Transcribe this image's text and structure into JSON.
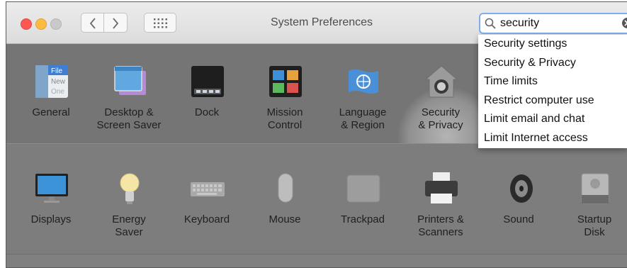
{
  "window": {
    "title": "System Preferences"
  },
  "search": {
    "value": "security"
  },
  "suggestions": [
    "Security settings",
    "Security & Privacy",
    "Time limits",
    "Restrict computer use",
    "Limit email and chat",
    "Limit Internet access"
  ],
  "row1": [
    {
      "label": "General",
      "icon": "general-icon"
    },
    {
      "label": "Desktop &\nScreen Saver",
      "icon": "desktop-icon"
    },
    {
      "label": "Dock",
      "icon": "dock-icon"
    },
    {
      "label": "Mission\nControl",
      "icon": "mission-control-icon"
    },
    {
      "label": "Language\n& Region",
      "icon": "globe-flag-icon"
    },
    {
      "label": "Security\n& Privacy",
      "icon": "house-lock-icon"
    }
  ],
  "row2": [
    {
      "label": "Displays",
      "icon": "monitor-icon"
    },
    {
      "label": "Energy\nSaver",
      "icon": "lightbulb-icon"
    },
    {
      "label": "Keyboard",
      "icon": "keyboard-icon"
    },
    {
      "label": "Mouse",
      "icon": "mouse-icon"
    },
    {
      "label": "Trackpad",
      "icon": "trackpad-icon"
    },
    {
      "label": "Printers &\nScanners",
      "icon": "printer-icon"
    },
    {
      "label": "Sound",
      "icon": "speaker-icon"
    },
    {
      "label": "Startup\nDisk",
      "icon": "disk-icon"
    }
  ],
  "general_icon_text": [
    "File",
    "New",
    "One"
  ]
}
